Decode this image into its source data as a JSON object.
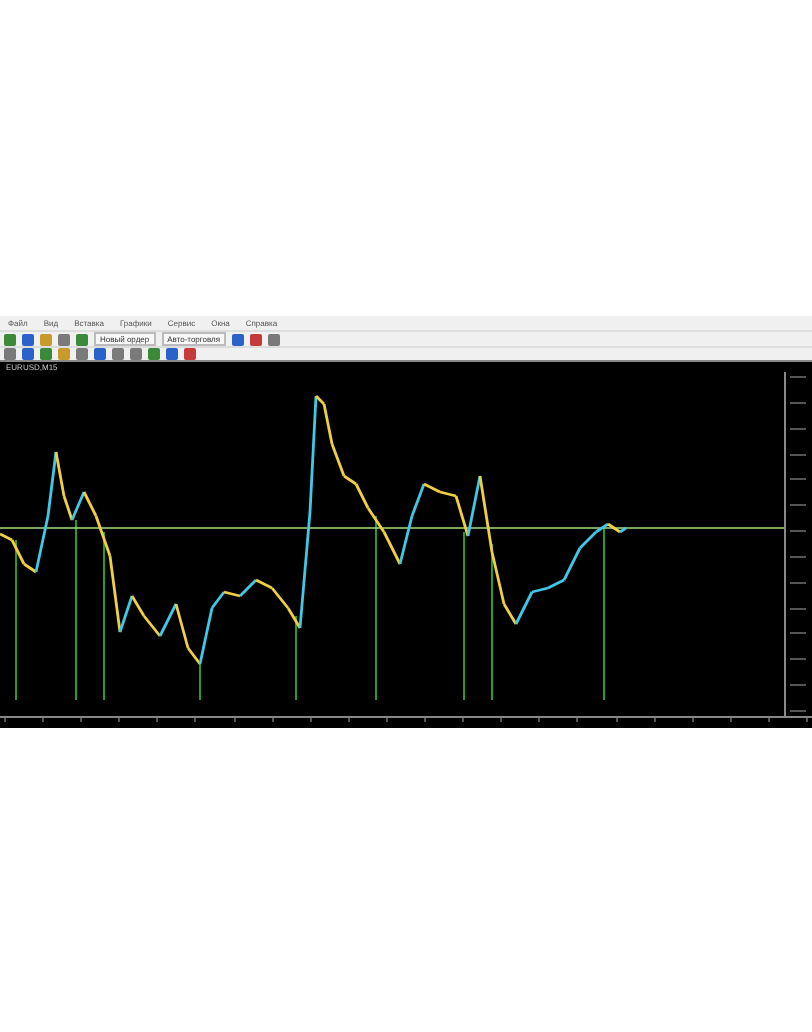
{
  "menu": [
    "Файл",
    "Вид",
    "Вставка",
    "Графики",
    "Сервис",
    "Окна",
    "Справка"
  ],
  "toolbar": {
    "buttons": [
      {
        "label": "Новый ордер"
      },
      {
        "label": "Авто-торговля"
      }
    ]
  },
  "chart": {
    "title": "EURUSD,M15"
  }
}
